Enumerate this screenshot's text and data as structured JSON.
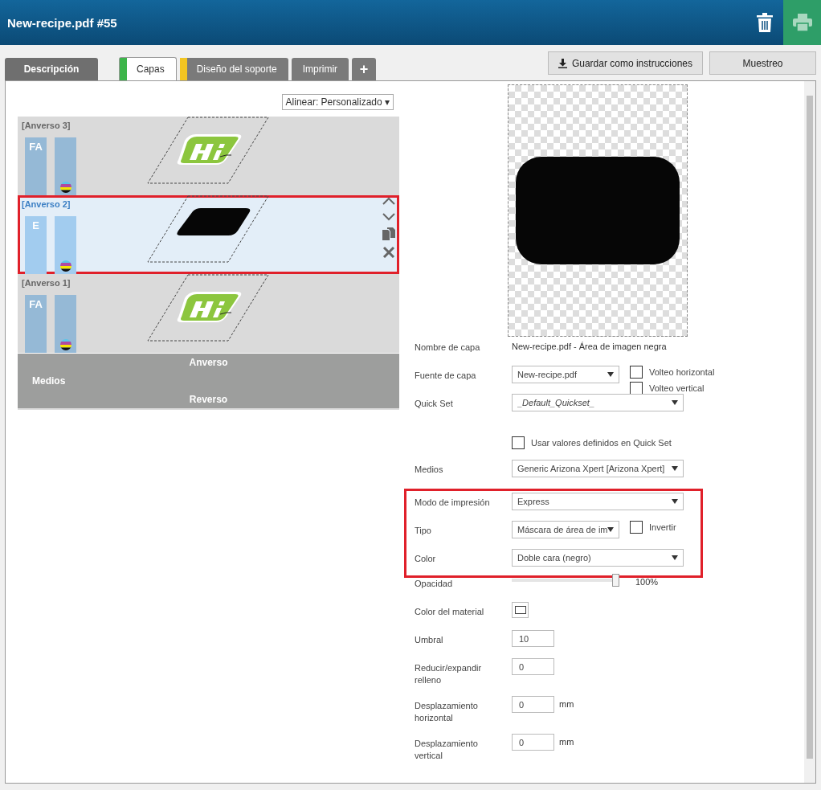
{
  "window": {
    "title": "New-recipe.pdf #55"
  },
  "tabs": [
    {
      "label": "Descripción",
      "selected": false
    },
    {
      "label": "Capas",
      "selected": true,
      "color": "#3cb54a"
    },
    {
      "label": "Diseño del soporte",
      "selected": false,
      "color": "#f2c522"
    },
    {
      "label": "Imprimir",
      "selected": false
    }
  ],
  "add_tab": "+",
  "actions": [
    {
      "label": "Guardar como instrucciones",
      "kind": "download"
    },
    {
      "label": "Muestreo",
      "kind": "plain"
    }
  ],
  "align_dropdown": "Alinear: Personalizado ▾",
  "layers": [
    {
      "name": "[Anverso 3]",
      "badge": "FA",
      "selected": false,
      "highlighted": false,
      "kind": "logo"
    },
    {
      "name": "[Anverso 2]",
      "badge": "E",
      "selected": true,
      "highlighted": true,
      "kind": "mask"
    },
    {
      "name": "[Anverso 1]",
      "badge": "FA",
      "selected": false,
      "highlighted": false,
      "kind": "logo"
    }
  ],
  "media_bar": {
    "front": "Anverso",
    "label": "Medios",
    "back": "Reverso"
  },
  "fields": [
    {
      "kind": "text",
      "label": "Nombre de capa",
      "value": "New-recipe.pdf - Área de imagen negra"
    },
    {
      "kind": "select",
      "label": "Fuente de capa",
      "value": "New-recipe.pdf",
      "narrow": true,
      "checks": [
        {
          "label": "Volteo horizontal",
          "checked": false
        },
        {
          "label": "Volteo vertical",
          "checked": false
        }
      ]
    },
    {
      "kind": "select",
      "label": "Quick Set",
      "value": "_Default_Quickset_",
      "italic": true
    },
    {
      "kind": "checkbox",
      "label": "Usar valores definidos en Quick Set",
      "checked": false
    },
    {
      "kind": "select",
      "label": "Medios",
      "value": "Generic Arizona Xpert [Arizona Xpert]"
    },
    {
      "kind": "select",
      "label": "Modo de impresión",
      "value": "Express",
      "highlighted": true
    },
    {
      "kind": "select",
      "label": "Tipo",
      "value": "Máscara de área de im",
      "narrow": true,
      "highlighted": true,
      "checks": [
        {
          "label": "Invertir",
          "checked": false
        }
      ]
    },
    {
      "kind": "select",
      "label": "Color",
      "value": "Doble cara (negro)",
      "highlighted": true
    },
    {
      "kind": "slider",
      "label": "Opacidad",
      "level": 1,
      "reading": "100%"
    },
    {
      "kind": "swatch",
      "label": "Color del material",
      "color": "#ffffff"
    },
    {
      "kind": "number",
      "label": "Umbral",
      "value": "10"
    },
    {
      "kind": "number",
      "label": "Reducir/expandir relleno",
      "value": "0"
    },
    {
      "kind": "number",
      "label": "Desplazamiento horizontal",
      "value": "0",
      "unit": "mm"
    },
    {
      "kind": "number",
      "label": "Desplazamiento vertical",
      "value": "0",
      "unit": "mm"
    }
  ]
}
